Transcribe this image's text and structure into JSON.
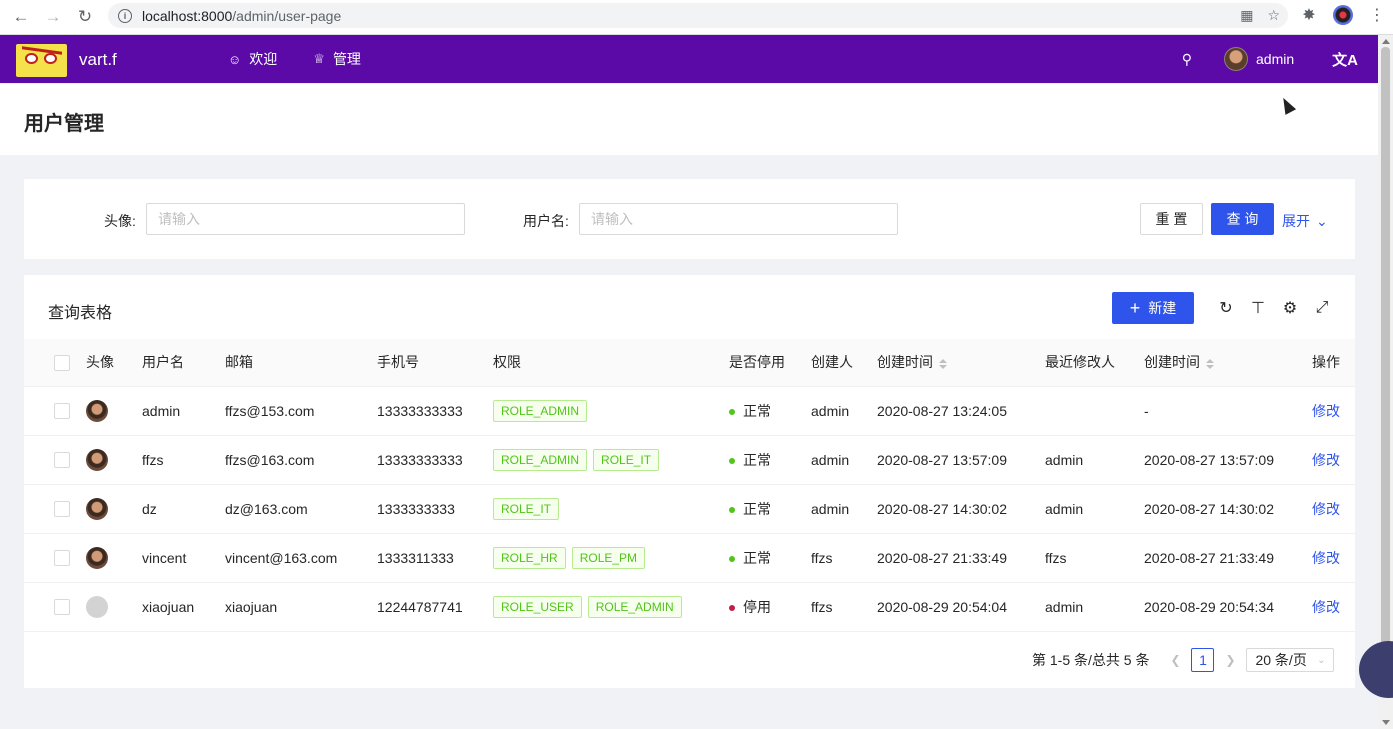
{
  "browser": {
    "url_host": "localhost:8000",
    "url_path": "/admin/user-page",
    "back_icon": "arrow-left-icon",
    "forward_icon": "arrow-right-icon",
    "reload_icon": "reload-icon"
  },
  "header": {
    "brand": "vart.f",
    "nav": [
      {
        "label": "欢迎",
        "icon": "smile-icon"
      },
      {
        "label": "管理",
        "icon": "crown-icon"
      }
    ],
    "username": "admin"
  },
  "page": {
    "title": "用户管理"
  },
  "search": {
    "avatar_label": "头像:",
    "avatar_placeholder": "请输入",
    "username_label": "用户名:",
    "username_placeholder": "请输入",
    "reset_label": "重 置",
    "query_label": "查 询",
    "expand_label": "展开"
  },
  "table": {
    "title": "查询表格",
    "new_label": "新建",
    "columns": [
      "头像",
      "用户名",
      "邮箱",
      "手机号",
      "权限",
      "是否停用",
      "创建人",
      "创建时间",
      "最近修改人",
      "创建时间",
      "操作"
    ],
    "rows": [
      {
        "avatar": "photo",
        "username": "admin",
        "email": "ffzs@153.com",
        "phone": "13333333333",
        "roles": [
          "ROLE_ADMIN"
        ],
        "status": "正常",
        "status_color": "#52c41a",
        "creator": "admin",
        "created": "2020-08-27 13:24:05",
        "modifier": "",
        "modified": "-",
        "action": "修改"
      },
      {
        "avatar": "photo",
        "username": "ffzs",
        "email": "ffzs@163.com",
        "phone": "13333333333",
        "roles": [
          "ROLE_ADMIN",
          "ROLE_IT"
        ],
        "status": "正常",
        "status_color": "#52c41a",
        "creator": "admin",
        "created": "2020-08-27 13:57:09",
        "modifier": "admin",
        "modified": "2020-08-27 13:57:09",
        "action": "修改"
      },
      {
        "avatar": "photo",
        "username": "dz",
        "email": "dz@163.com",
        "phone": "1333333333",
        "roles": [
          "ROLE_IT"
        ],
        "status": "正常",
        "status_color": "#52c41a",
        "creator": "admin",
        "created": "2020-08-27 14:30:02",
        "modifier": "admin",
        "modified": "2020-08-27 14:30:02",
        "action": "修改"
      },
      {
        "avatar": "photo",
        "username": "vincent",
        "email": "vincent@163.com",
        "phone": "1333311333",
        "roles": [
          "ROLE_HR",
          "ROLE_PM"
        ],
        "status": "正常",
        "status_color": "#52c41a",
        "creator": "ffzs",
        "created": "2020-08-27 21:33:49",
        "modifier": "ffzs",
        "modified": "2020-08-27 21:33:49",
        "action": "修改"
      },
      {
        "avatar": "blank",
        "username": "xiaojuan",
        "email": "xiaojuan",
        "phone": "12244787741",
        "roles": [
          "ROLE_USER",
          "ROLE_ADMIN"
        ],
        "status": "停用",
        "status_color": "#c41d48",
        "creator": "ffzs",
        "created": "2020-08-29 20:54:04",
        "modifier": "admin",
        "modified": "2020-08-29 20:54:34",
        "action": "修改"
      }
    ]
  },
  "pagination": {
    "total_text": "第 1-5 条/总共 5 条",
    "current_page": "1",
    "page_size": "20 条/页"
  },
  "colors": {
    "header_bg": "#5b0aa8",
    "primary": "#2f54eb",
    "tag_green": "#52c41a",
    "status_stopped": "#c41d48"
  }
}
